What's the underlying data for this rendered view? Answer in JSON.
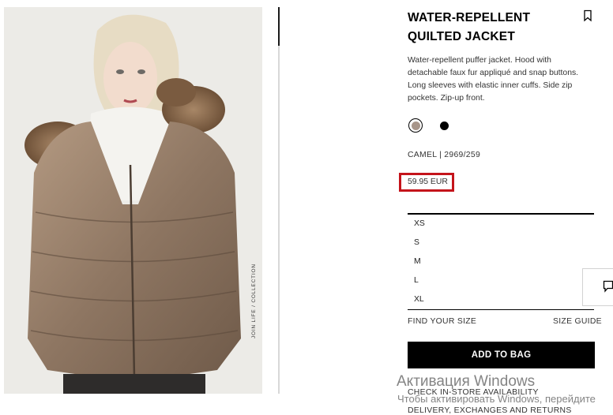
{
  "product": {
    "image_description": "Model wearing a camel water-repellent quilted puffer jacket with faux fur hood",
    "photo_credit": "JOIN LIFE / COLLECTION",
    "title": "WATER-REPELLENT QUILTED JACKET",
    "description": "Water-repellent puffer jacket. Hood with detachable faux fur appliqué and snap buttons. Long sleeves with elastic inner cuffs. Side zip pockets. Zip-up front.",
    "colors": [
      {
        "name": "camel",
        "hex": "#a8968a",
        "selected": true
      },
      {
        "name": "black",
        "hex": "#000000",
        "selected": false
      }
    ],
    "variant": "CAMEL | 2969/259",
    "price": "59.95 EUR",
    "sizes": [
      "XS",
      "S",
      "M",
      "L",
      "XL"
    ]
  },
  "actions": {
    "find_size": "FIND YOUR SIZE",
    "size_guide": "SIZE GUIDE",
    "add_to_bag": "ADD TO BAG",
    "store_availability": "CHECK IN-STORE AVAILABILITY",
    "delivery": "DELIVERY, EXCHANGES AND RETURNS"
  },
  "windows_watermark": {
    "title": "Активация Windows",
    "subtitle": "Чтобы активировать Windows, перейдите"
  },
  "colors": {
    "highlight": "#c4141b",
    "button_bg": "#000000"
  }
}
